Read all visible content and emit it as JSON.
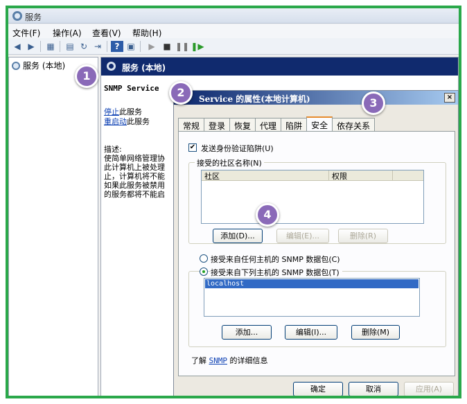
{
  "window": {
    "title": "服务"
  },
  "menu": [
    "文件(F)",
    "操作(A)",
    "查看(V)",
    "帮助(H)"
  ],
  "tree": {
    "root_label": "服务 (本地)"
  },
  "right_pane": {
    "header": "服务 (本地)",
    "service_name": "SNMP Service",
    "stop_link": "停止",
    "stop_suffix": "此服务",
    "restart_link": "重启动",
    "restart_suffix": "此服务",
    "desc_label": "描述:",
    "desc_lines": [
      "使简单网络管理协",
      "此计算机上被处理",
      "止，计算机将不能",
      "如果此服务被禁用",
      "的服务都将不能启"
    ]
  },
  "dialog": {
    "title": "Service 的属性(本地计算机)",
    "close": "×",
    "tabs": [
      "常规",
      "登录",
      "恢复",
      "代理",
      "陷阱",
      "安全",
      "依存关系"
    ],
    "active_tab": "安全",
    "send_auth_trap": {
      "label": "发送身份验证陷阱(U)",
      "checked": true
    },
    "communities": {
      "legend": "接受的社区名称(N)",
      "columns": [
        "社区",
        "权限"
      ],
      "rows": [],
      "buttons": {
        "add": "添加(D)...",
        "edit": "编辑(E)...",
        "remove": "删除(R)"
      }
    },
    "accept_any": {
      "label": "接受来自任何主机的 SNMP 数据包(C)",
      "selected": false
    },
    "accept_list": {
      "label": "接受来自下列主机的 SNMP 数据包(T)",
      "selected": true
    },
    "hosts": [
      "localhost"
    ],
    "host_buttons": {
      "add": "添加...",
      "edit": "编辑(I)...",
      "remove": "删除(M)"
    },
    "learn_prefix": "了解",
    "learn_link": "SNMP",
    "learn_suffix": "的详细信息",
    "footer": {
      "ok": "确定",
      "cancel": "取消",
      "apply": "应用(A)"
    }
  },
  "callouts": [
    "1",
    "2",
    "3",
    "4"
  ],
  "colors": {
    "frame": "#2aa84a",
    "header": "#102a6e",
    "callout": "#8a6ab8"
  }
}
